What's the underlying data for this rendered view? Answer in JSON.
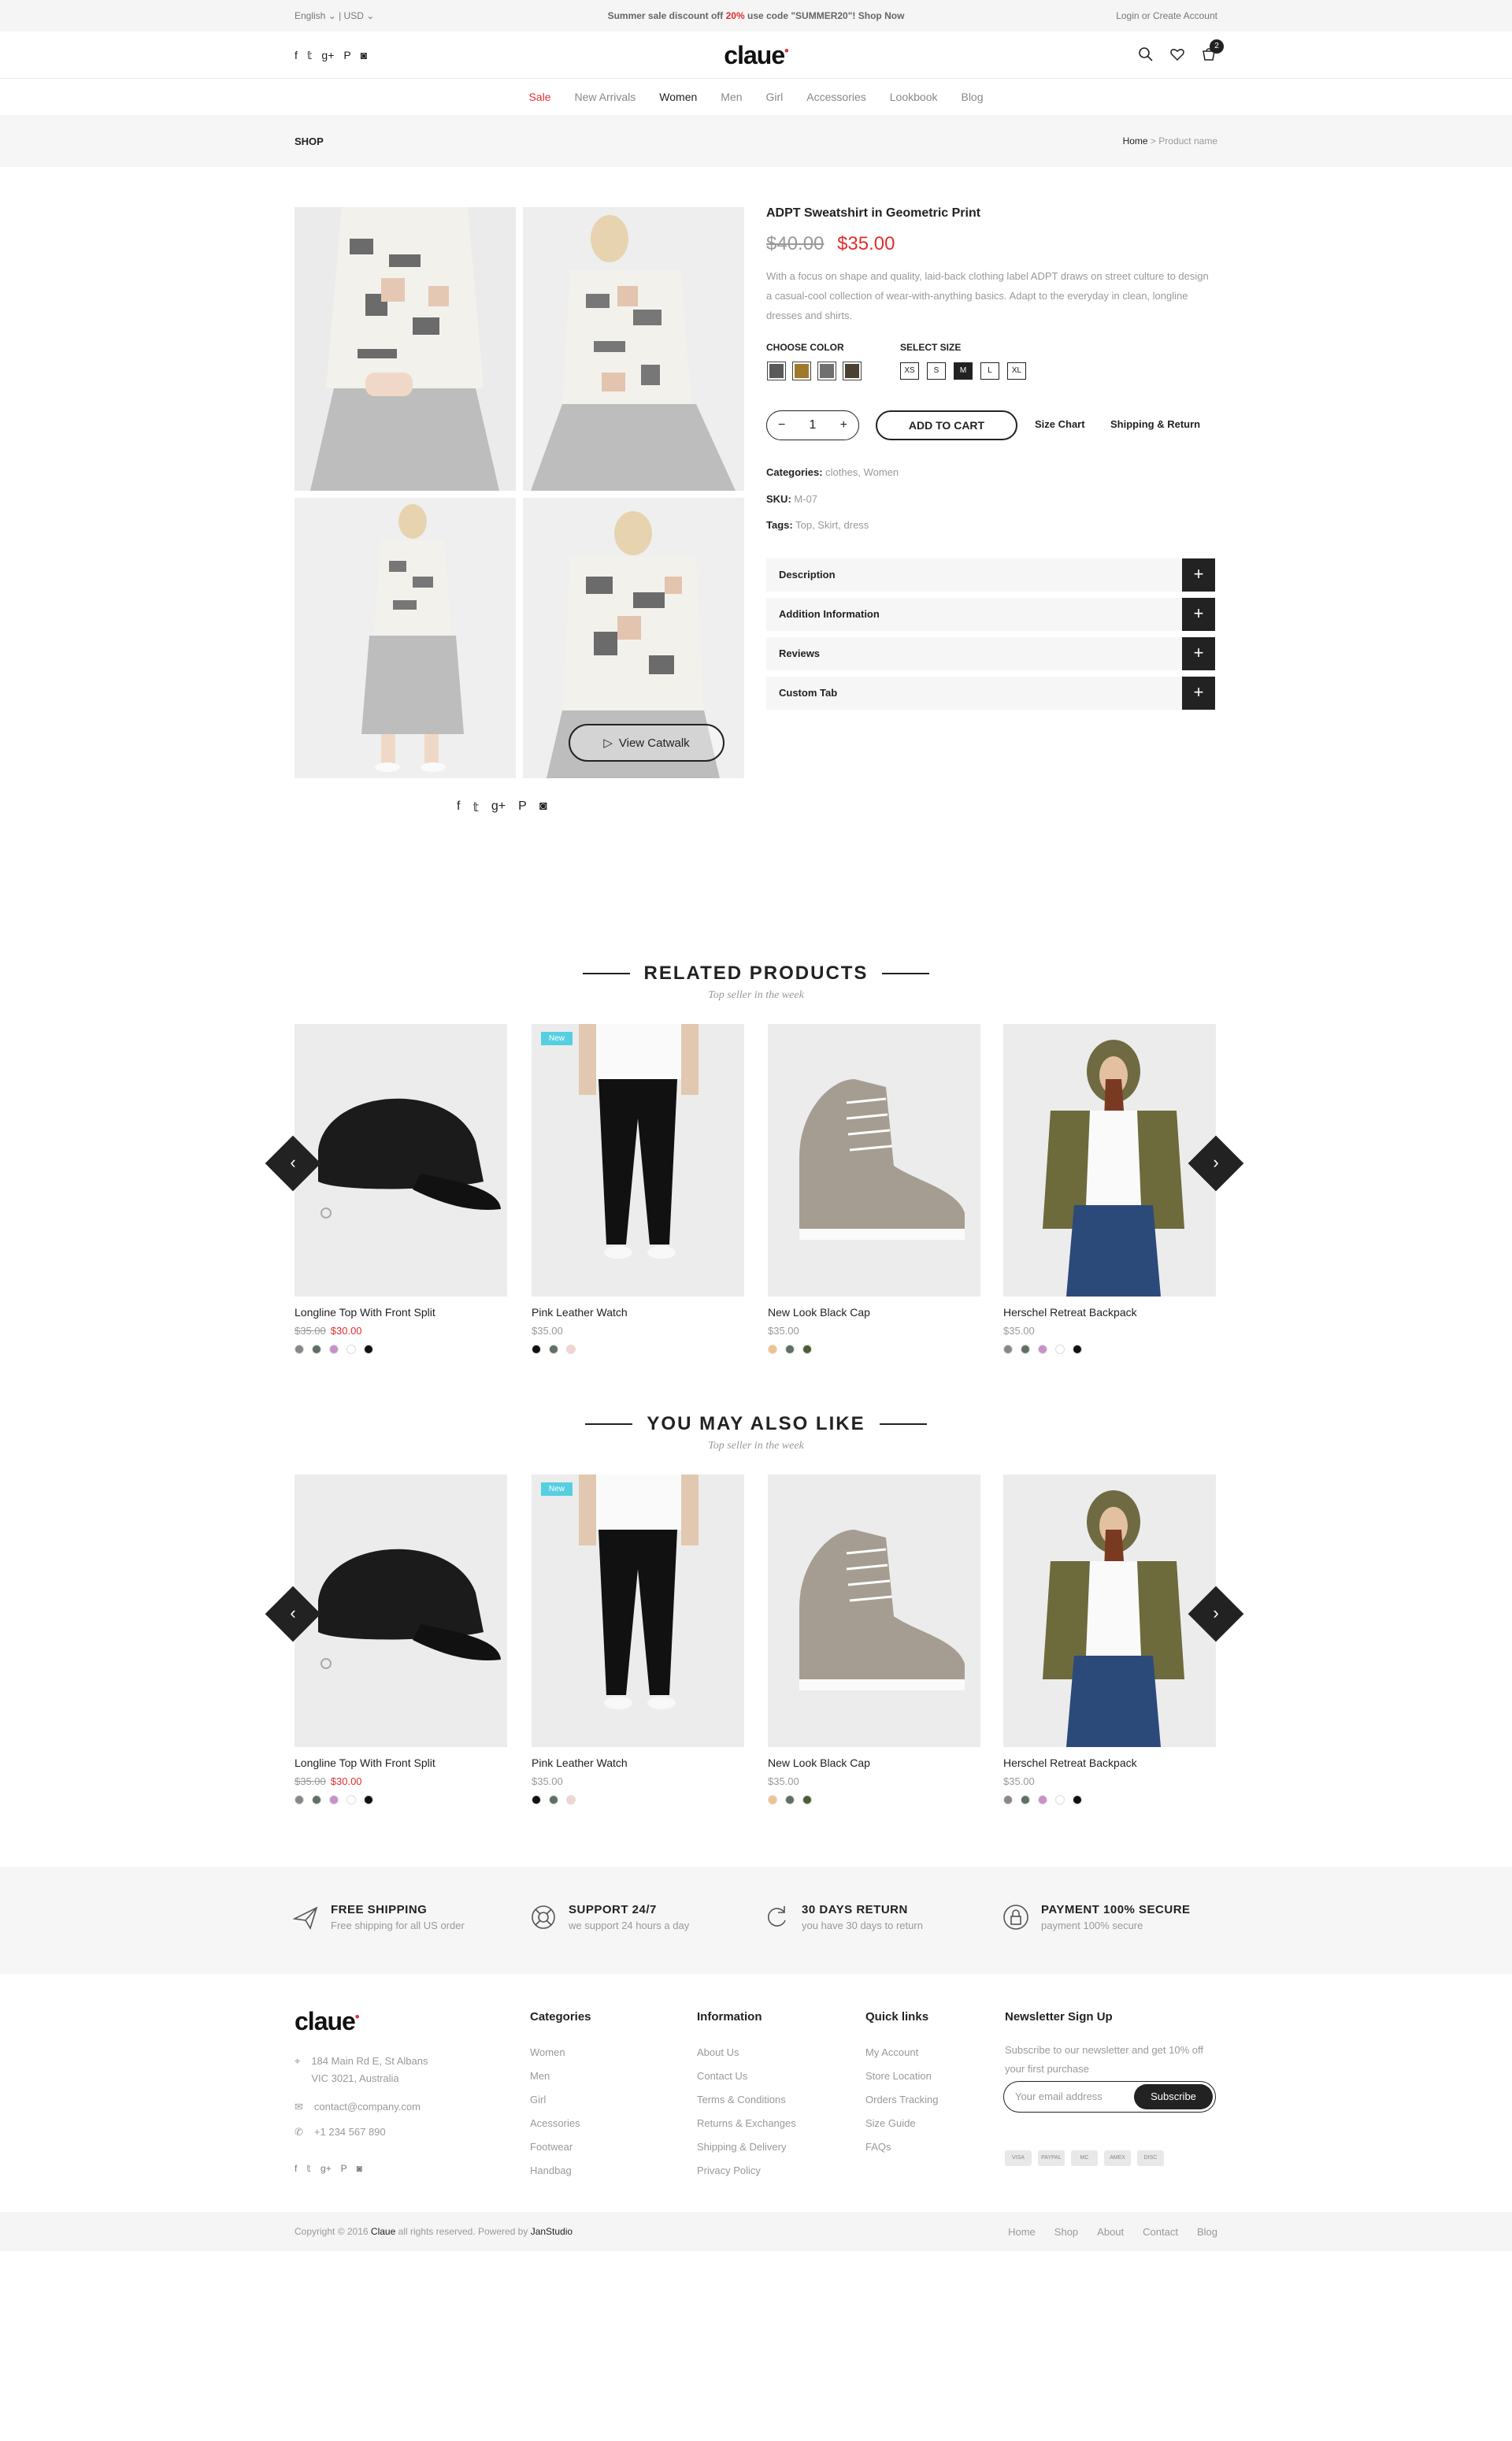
{
  "topbar": {
    "language": "English",
    "currency": "USD",
    "promo_pre": "Summer sale discount off",
    "promo_pct": "20%",
    "promo_post": "use code \"SUMMER20\"! Shop Now",
    "login": "Login",
    "or": "or",
    "create": "Create Account"
  },
  "header": {
    "logo": "claue",
    "cart_count": "2"
  },
  "nav": [
    "Sale",
    "New Arrivals",
    "Women",
    "Men",
    "Girl",
    "Accessories",
    "Lookbook",
    "Blog"
  ],
  "crumb": {
    "title": "SHOP",
    "home": "Home",
    "sep": ">",
    "current": "Product name"
  },
  "product": {
    "title": "ADPT Sweatshirt in Geometric Print",
    "old_price": "$40.00",
    "price": "$35.00",
    "description": "With a focus on shape and quality, laid-back clothing label ADPT draws on street culture to design a casual-cool collection of wear-with-anything basics. Adapt to the everyday in clean, longline dresses and shirts.",
    "choose_color": "CHOOSE COLOR",
    "select_size": "SELECT SIZE",
    "colors": [
      "#5a5a5a",
      "#a07a2c",
      "#6f6f6f",
      "#4a4033"
    ],
    "sizes": [
      "XS",
      "S",
      "M",
      "L",
      "XL"
    ],
    "selected_size": "M",
    "qty": "1",
    "minus": "−",
    "plus": "+",
    "add_to_cart": "ADD TO CART",
    "size_chart": "Size Chart",
    "shipping_return": "Shipping & Return",
    "categories_label": "Categories:",
    "categories": "clothes, Women",
    "sku_label": "SKU:",
    "sku": "M-07",
    "tags_label": "Tags:",
    "tags": "Top, Skirt, dress",
    "view_catwalk": "View Catwalk",
    "tabs": [
      "Description",
      "Addition Information",
      "Reviews",
      "Custom Tab"
    ]
  },
  "related": {
    "title": "RELATED PRODUCTS",
    "subtitle": "Top seller in the week",
    "items": [
      {
        "name": "Longline Top With Front Split",
        "old": "$35.00",
        "price": "$30.00",
        "badge": "",
        "colors": [
          "#888888",
          "#5e6f64",
          "#c790c9",
          "#ffffff",
          "#111111"
        ]
      },
      {
        "name": "Pink Leather Watch",
        "old": "",
        "price": "$35.00",
        "badge": "New",
        "colors": [
          "#111111",
          "#5e6f64",
          "#f1d6d0"
        ]
      },
      {
        "name": "New Look Black Cap",
        "old": "",
        "price": "$35.00",
        "badge": "",
        "colors": [
          "#f0c28c",
          "#5e6f64",
          "#4b5c3a"
        ]
      },
      {
        "name": "Herschel Retreat Backpack",
        "old": "",
        "price": "$35.00",
        "badge": "",
        "colors": [
          "#888888",
          "#5e6f64",
          "#c790c9",
          "#ffffff",
          "#111111"
        ]
      }
    ]
  },
  "also": {
    "title": "YOU MAY ALSO LIKE",
    "subtitle": "Top seller in the week",
    "items": [
      {
        "name": "Longline Top With Front Split",
        "old": "$35.00",
        "price": "$30.00",
        "badge": "",
        "colors": [
          "#888888",
          "#5e6f64",
          "#c790c9",
          "#ffffff",
          "#111111"
        ]
      },
      {
        "name": "Pink Leather Watch",
        "old": "",
        "price": "$35.00",
        "badge": "New",
        "colors": [
          "#111111",
          "#5e6f64",
          "#f1d6d0"
        ]
      },
      {
        "name": "New Look Black Cap",
        "old": "",
        "price": "$35.00",
        "badge": "",
        "colors": [
          "#f0c28c",
          "#5e6f64",
          "#4b5c3a"
        ]
      },
      {
        "name": "Herschel Retreat Backpack",
        "old": "",
        "price": "$35.00",
        "badge": "",
        "colors": [
          "#888888",
          "#5e6f64",
          "#c790c9",
          "#ffffff",
          "#111111"
        ]
      }
    ]
  },
  "services": [
    {
      "title": "FREE SHIPPING",
      "desc": "Free shipping for all US order",
      "icon": "plane-icon"
    },
    {
      "title": "SUPPORT 24/7",
      "desc": "we support 24 hours a day",
      "icon": "lifebuoy-icon"
    },
    {
      "title": "30 DAYS RETURN",
      "desc": "you have 30 days to return",
      "icon": "refresh-icon"
    },
    {
      "title": "PAYMENT 100% SECURE",
      "desc": "payment 100% secure",
      "icon": "lock-icon"
    }
  ],
  "footer": {
    "logo": "claue",
    "address1": "184 Main Rd E, St Albans",
    "address2": "VIC 3021, Australia",
    "email": "contact@company.com",
    "phone": "+1 234 567 890",
    "categories": {
      "title": "Categories",
      "items": [
        "Women",
        "Men",
        "Girl",
        "Acessories",
        "Footwear",
        "Handbag"
      ]
    },
    "information": {
      "title": "Information",
      "items": [
        "About Us",
        "Contact Us",
        "Terms & Conditions",
        "Returns & Exchanges",
        "Shipping & Delivery",
        "Privacy Policy"
      ]
    },
    "quicklinks": {
      "title": "Quick links",
      "items": [
        "My Account",
        "Store Location",
        "Orders Tracking",
        "Size Guide",
        "FAQs"
      ]
    },
    "newsletter": {
      "title": "Newsletter Sign Up",
      "text": "Subscribe to our newsletter and get 10% off your first purchase",
      "placeholder": "Your email address",
      "button": "Subscribe"
    },
    "payments": [
      "VISA",
      "PAYPAL",
      "MC",
      "AMEX",
      "DISC"
    ]
  },
  "copyright": {
    "pre": "Copyright © 2016",
    "brand": "Claue",
    "mid": "all rights reserved. Powered by",
    "powered": "JanStudio",
    "links": [
      "Home",
      "Shop",
      "About",
      "Contact",
      "Blog"
    ]
  }
}
